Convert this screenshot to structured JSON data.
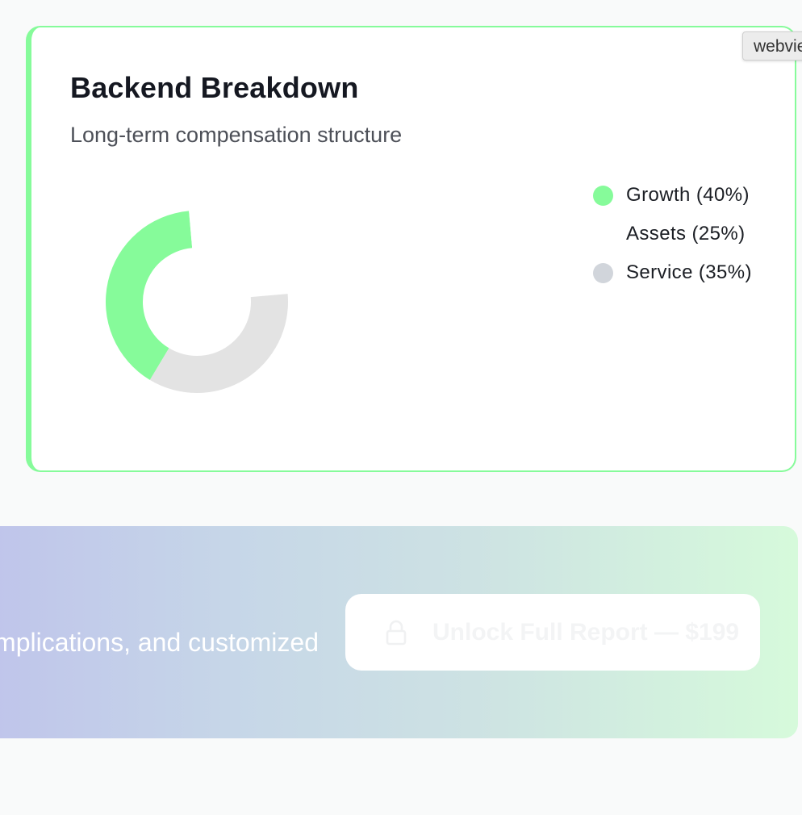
{
  "card": {
    "title": "Backend Breakdown",
    "subtitle": "Long-term compensation structure"
  },
  "chart_data": {
    "type": "pie",
    "donut": true,
    "title": "",
    "categories": [
      "Growth",
      "Assets",
      "Service"
    ],
    "values": [
      40,
      25,
      35
    ],
    "colors": [
      "#86fb9a",
      "#ffffff",
      "#e3e3e3"
    ],
    "legend": [
      {
        "label": "Growth (40%)",
        "color": "#86fb9a"
      },
      {
        "label": "Assets (25%)",
        "color": "#ffffff"
      },
      {
        "label": "Service (35%)",
        "color": "#d1d5db"
      }
    ],
    "legend_position": "right"
  },
  "tooltip": {
    "text": "webview"
  },
  "banner": {
    "text": "mplications, and customized",
    "button_label": "Unlock Full Report — $199",
    "button_icon": "lock-icon"
  }
}
